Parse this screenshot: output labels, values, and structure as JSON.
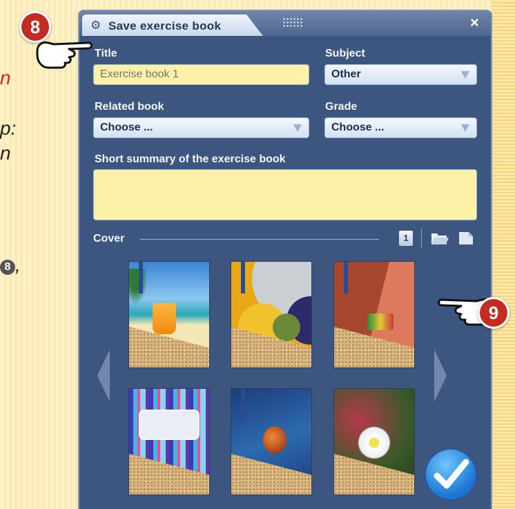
{
  "background": {
    "partial_red": "n",
    "partial_line1": "p:",
    "partial_line2": "n",
    "partial_marker": "8",
    "partial_comma": ","
  },
  "dialog": {
    "title": "Save exercise book",
    "title_icon": "gear-icon",
    "close_label": "×",
    "fields": {
      "title_label": "Title",
      "title_placeholder": "Exercise book 1",
      "subject_label": "Subject",
      "subject_value": "Other",
      "related_book_label": "Related book",
      "related_book_value": "Choose ...",
      "grade_label": "Grade",
      "grade_value": "Choose ...",
      "summary_label": "Short summary of the exercise book",
      "summary_value": ""
    },
    "cover": {
      "label": "Cover",
      "page_number_icon_label": "1",
      "thumbnails": [
        {
          "name": "beach-cocktail-cover"
        },
        {
          "name": "geometric-circles-cover"
        },
        {
          "name": "red-toy-cover"
        },
        {
          "name": "colorful-stripes-cover"
        },
        {
          "name": "blue-orb-cover"
        },
        {
          "name": "frosted-flower-cover"
        }
      ]
    }
  },
  "callouts": {
    "step_8": "8",
    "step_9": "9"
  },
  "colors": {
    "dialog_bg": "#3c5680",
    "title_field_bg": "#fcf1a6",
    "callout_red": "#c42b22",
    "confirm_blue": "#1a75d0"
  }
}
